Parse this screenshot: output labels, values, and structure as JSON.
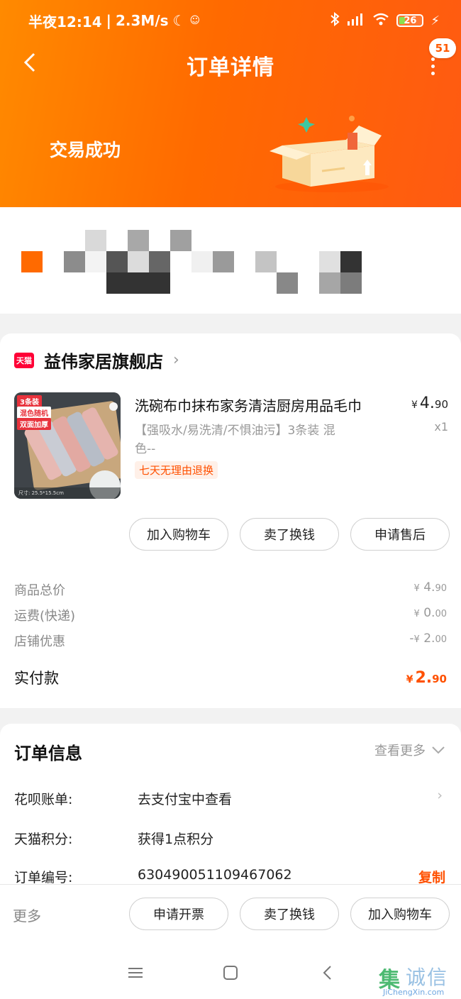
{
  "status_bar": {
    "time": "半夜12:14",
    "speed": "2.3M/s",
    "battery": "26",
    "battery_level": 0.26
  },
  "header": {
    "title": "订单详情",
    "message_count": "51",
    "trade_status": "交易成功"
  },
  "shop": {
    "badge": "天猫",
    "name": "益伟家居旗舰店"
  },
  "product": {
    "title": "洗碗布巾抹布家务清洁厨房用品毛巾",
    "sku_line1": "【强吸水/易洗清/不惧油污】3条装 混",
    "sku_line2": "色--",
    "refund_tag": "七天无理由退换",
    "currency": "¥",
    "price_int": "4.",
    "price_dec": "90",
    "quantity": "x1",
    "thumb_tags": [
      "3条装",
      "混色随机",
      "双面加厚"
    ],
    "thumb_size": "尺寸: 25.5*15.5cm"
  },
  "product_actions": {
    "add_cart": "加入购物车",
    "sell": "卖了换钱",
    "after_sale": "申请售后"
  },
  "price_summary": {
    "total_label": "商品总价",
    "total_int": "4.",
    "total_dec": "90",
    "shipping_label": "运费(快递)",
    "shipping_int": "0.",
    "shipping_dec": "00",
    "discount_label": "店铺优惠",
    "discount_prefix": "-",
    "discount_int": "2.",
    "discount_dec": "00",
    "paid_label": "实付款",
    "paid_int": "2.",
    "paid_dec": "90",
    "currency": "¥"
  },
  "order_info": {
    "title": "订单信息",
    "view_more": "查看更多",
    "rows": [
      {
        "label": "花呗账单:",
        "value": "去支付宝中查看"
      },
      {
        "label": "天猫积分:",
        "value": "获得1点积分"
      },
      {
        "label": "订单编号:",
        "value": "630490051109467062",
        "action": "复制"
      }
    ]
  },
  "bottom_bar": {
    "more": "更多",
    "invoice": "申请开票",
    "sell": "卖了换钱",
    "add_cart": "加入购物车"
  },
  "watermark": {
    "logo": "集",
    "text": "诚信",
    "domain": "JiChengXin.com"
  },
  "colors": {
    "brand_orange": "#ff6a00",
    "price_orange": "#ff5000",
    "tmall_red": "#ff0036"
  }
}
